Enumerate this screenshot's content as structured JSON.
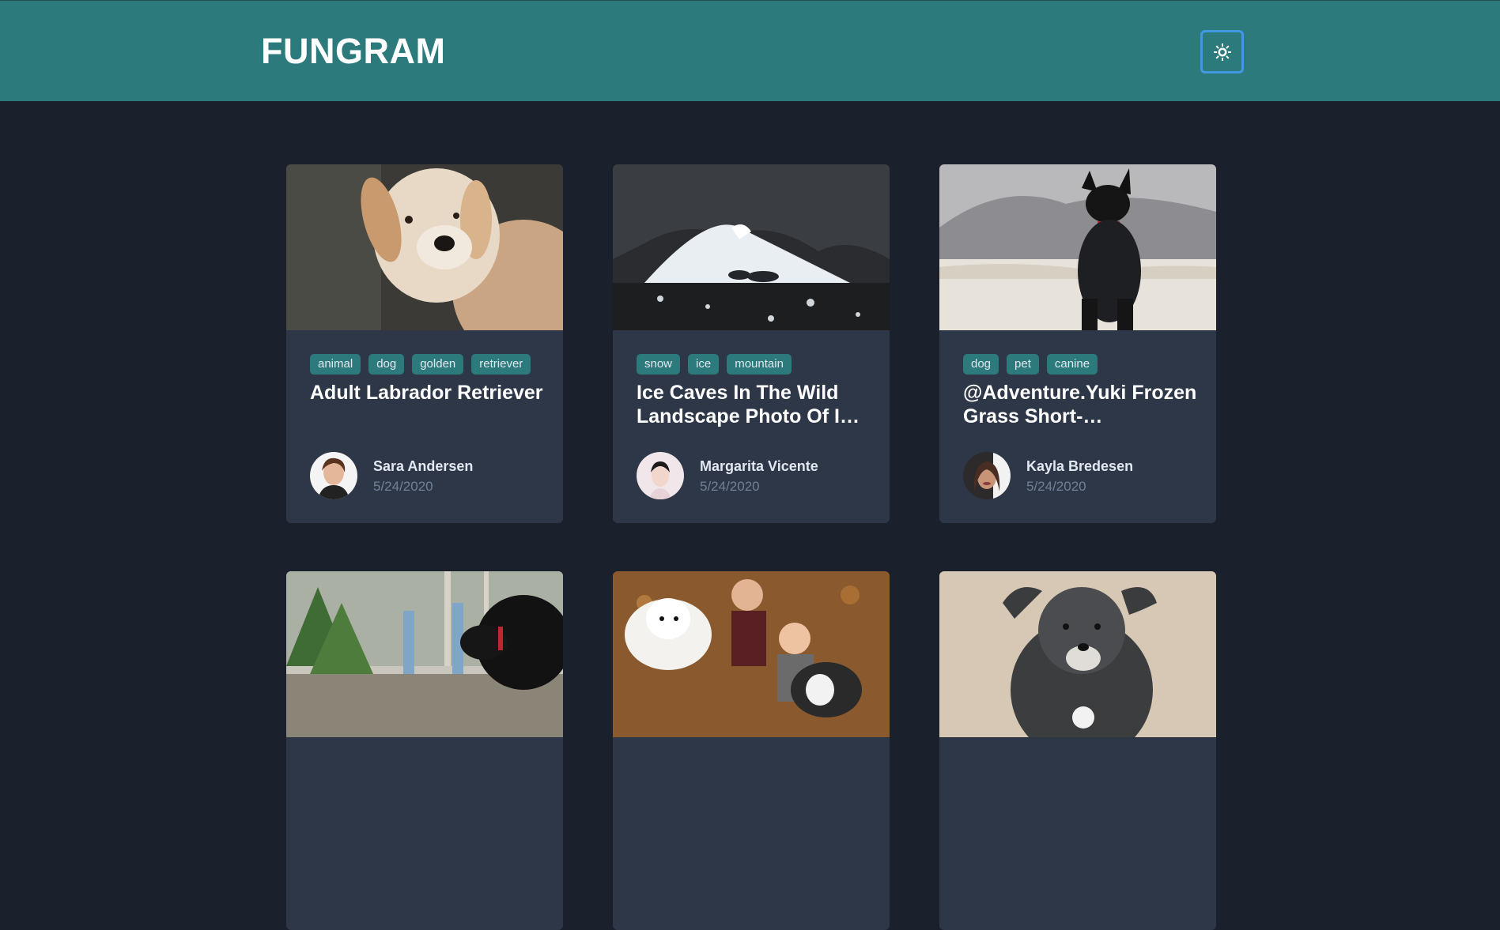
{
  "header": {
    "brand": "FUNGRAM",
    "theme_toggle_icon": "sun-icon"
  },
  "colors": {
    "header_bg": "#2c7a7b",
    "page_bg": "#1a202c",
    "card_bg": "#2d3748",
    "tag_bg": "#2c7a7b",
    "toggle_border": "#4299e1"
  },
  "cards": [
    {
      "tags": [
        "animal",
        "dog",
        "golden",
        "retriever"
      ],
      "title": "Adult Labrador Retriever",
      "author": "Sara Andersen",
      "date": "5/24/2020"
    },
    {
      "tags": [
        "snow",
        "ice",
        "mountain"
      ],
      "title": "Ice Caves In The Wild Landscape Photo Of I…",
      "author": "Margarita Vicente",
      "date": "5/24/2020"
    },
    {
      "tags": [
        "dog",
        "pet",
        "canine"
      ],
      "title": "@Adventure.Yuki Frozen Grass Short-…",
      "author": "Kayla Bredesen",
      "date": "5/24/2020"
    },
    {
      "tags": [],
      "title": "",
      "author": "",
      "date": ""
    },
    {
      "tags": [],
      "title": "",
      "author": "",
      "date": ""
    },
    {
      "tags": [],
      "title": "",
      "author": "",
      "date": ""
    }
  ]
}
